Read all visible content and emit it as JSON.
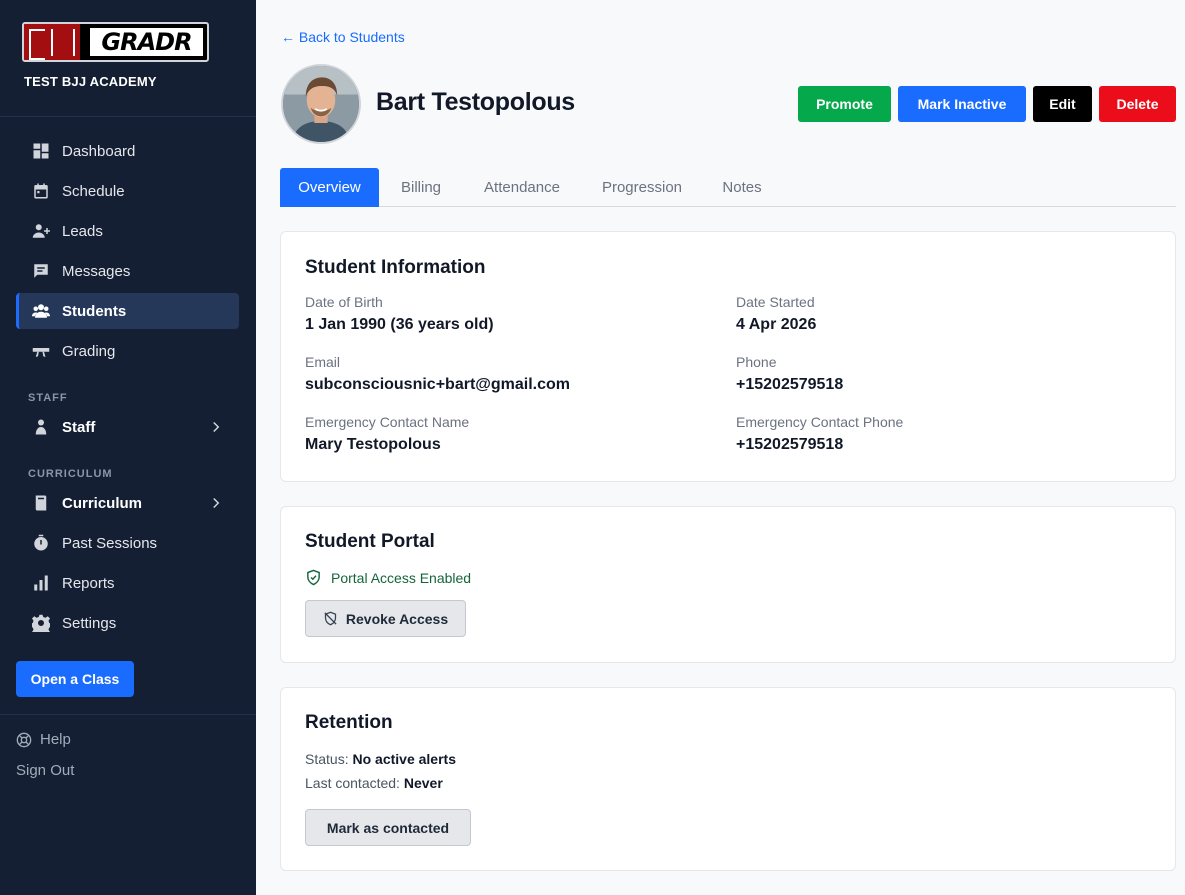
{
  "brand": {
    "logo_text": "GRADR",
    "academy": "TEST BJJ ACADEMY"
  },
  "sidebar": {
    "items": [
      {
        "label": "Dashboard",
        "icon": "dashboard-icon"
      },
      {
        "label": "Schedule",
        "icon": "calendar-icon"
      },
      {
        "label": "Leads",
        "icon": "add-user-icon"
      },
      {
        "label": "Messages",
        "icon": "chat-icon"
      },
      {
        "label": "Students",
        "icon": "users-icon",
        "active": true
      },
      {
        "label": "Grading",
        "icon": "belt-icon"
      }
    ],
    "staff_section": "STAFF",
    "staff_item": "Staff",
    "curriculum_section": "CURRICULUM",
    "curriculum_item": "Curriculum",
    "curriculum_items": [
      {
        "label": "Past Sessions",
        "icon": "stopwatch-icon"
      },
      {
        "label": "Reports",
        "icon": "bar-chart-icon"
      },
      {
        "label": "Settings",
        "icon": "gear-icon"
      }
    ],
    "open_class": "Open a Class",
    "help": "Help",
    "sign_out": "Sign Out"
  },
  "header": {
    "back_link": "← Back to Students",
    "student_name": "Bart Testopolous",
    "actions": {
      "promote": "Promote",
      "mark_inactive": "Mark Inactive",
      "edit": "Edit",
      "delete": "Delete"
    },
    "colors": {
      "promote": "#05a84a",
      "mark_inactive": "#1a6cff",
      "edit": "#000000",
      "delete": "#eb0e1a"
    }
  },
  "tabs": [
    "Overview",
    "Billing",
    "Attendance",
    "Progression",
    "Notes"
  ],
  "student_info": {
    "title": "Student Information",
    "fields": [
      {
        "label": "Date of Birth",
        "value": "1 Jan 1990 (36 years old)"
      },
      {
        "label": "Date Started",
        "value": "4 Apr 2026"
      },
      {
        "label": "Email",
        "value": "subconsciousnic+bart@gmail.com"
      },
      {
        "label": "Phone",
        "value": "+15202579518"
      },
      {
        "label": "Emergency Contact Name",
        "value": "Mary Testopolous"
      },
      {
        "label": "Emergency Contact Phone",
        "value": "+15202579518"
      }
    ]
  },
  "portal": {
    "title": "Student Portal",
    "status": "Portal Access Enabled",
    "revoke_button": "Revoke Access"
  },
  "retention": {
    "title": "Retention",
    "status_label": "Status:",
    "status_value": "No active alerts",
    "last_contacted_label": "Last contacted:",
    "last_contacted_value": "Never",
    "mark_button": "Mark as contacted"
  }
}
